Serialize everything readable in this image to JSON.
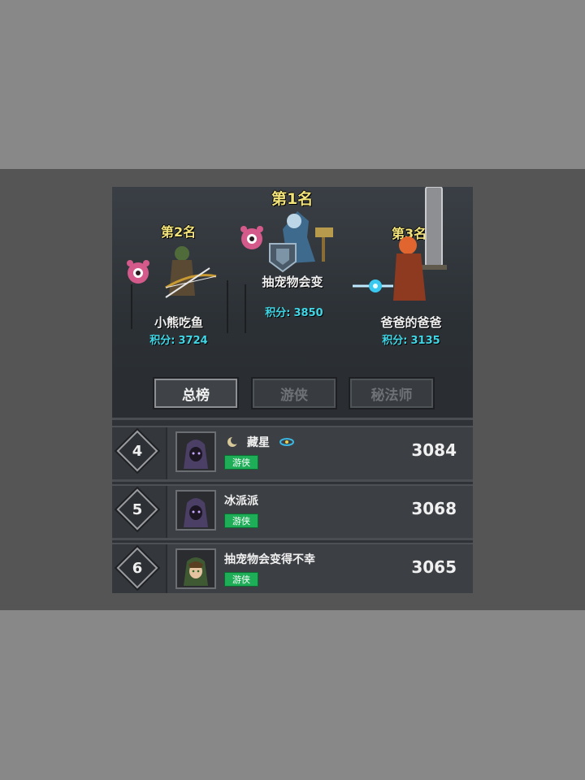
{
  "podium": {
    "first": {
      "title": "第1名",
      "name": "抽宠物会变",
      "score_label": "积分:",
      "score": "3850"
    },
    "second": {
      "title": "第2名",
      "name": "小熊吃鱼",
      "score_label": "积分:",
      "score": "3724"
    },
    "third": {
      "title": "第3名",
      "name": "爸爸的爸爸",
      "score_label": "积分:",
      "score": "3135"
    }
  },
  "tabs": [
    {
      "label": "总榜",
      "active": true
    },
    {
      "label": "游侠",
      "active": false
    },
    {
      "label": "秘法师",
      "active": false
    }
  ],
  "rows": [
    {
      "rank": "4",
      "name": "藏星",
      "class": "游侠",
      "score": "3084"
    },
    {
      "rank": "5",
      "name": "冰派派",
      "class": "游侠",
      "score": "3068"
    },
    {
      "rank": "6",
      "name": "抽宠物会变得不幸",
      "class": "游侠",
      "score": "3065"
    }
  ],
  "colors": {
    "title_yellow": "#f2e27a",
    "score_cyan": "#3fd6e6",
    "class_badge_green": "#1fae58"
  }
}
